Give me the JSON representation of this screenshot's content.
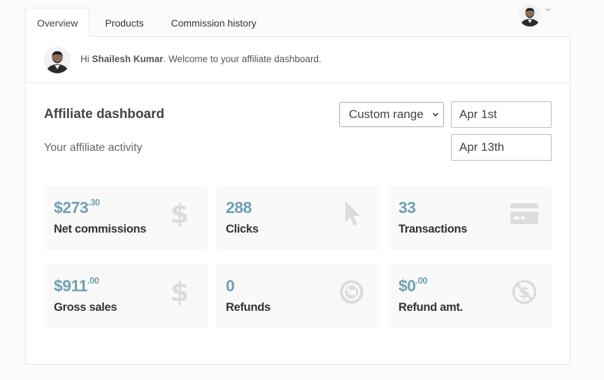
{
  "tabs": [
    {
      "label": "Overview",
      "active": true
    },
    {
      "label": "Products",
      "active": false
    },
    {
      "label": "Commission history",
      "active": false
    }
  ],
  "welcome": {
    "greeting": "Hi",
    "user_name": "Shailesh Kumar",
    "message": ". Welcome to your affiliate dashboard."
  },
  "dashboard": {
    "title": "Affiliate dashboard",
    "subtitle": "Your affiliate activity",
    "range_select": "Custom range",
    "date_from": "Apr 1st",
    "date_to": "Apr 13th"
  },
  "stats": {
    "net_commissions": {
      "whole": "$273",
      "cents": ".30",
      "label": "Net commissions",
      "icon": "dollar-icon"
    },
    "clicks": {
      "whole": "288",
      "cents": "",
      "label": "Clicks",
      "icon": "cursor-icon"
    },
    "transactions": {
      "whole": "33",
      "cents": "",
      "label": "Transactions",
      "icon": "credit-card-icon"
    },
    "gross_sales": {
      "whole": "$911",
      "cents": ".00",
      "label": "Gross sales",
      "icon": "dollar-icon"
    },
    "refunds": {
      "whole": "0",
      "cents": "",
      "label": "Refunds",
      "icon": "refund-icon"
    },
    "refund_amt": {
      "whole": "$0",
      "cents": ".00",
      "label": "Refund amt.",
      "icon": "no-dollar-icon"
    }
  },
  "colors": {
    "accent_value": "#6fa1b3",
    "icon_gray": "#dcdcdc",
    "card_bg": "#f9f9f9"
  }
}
